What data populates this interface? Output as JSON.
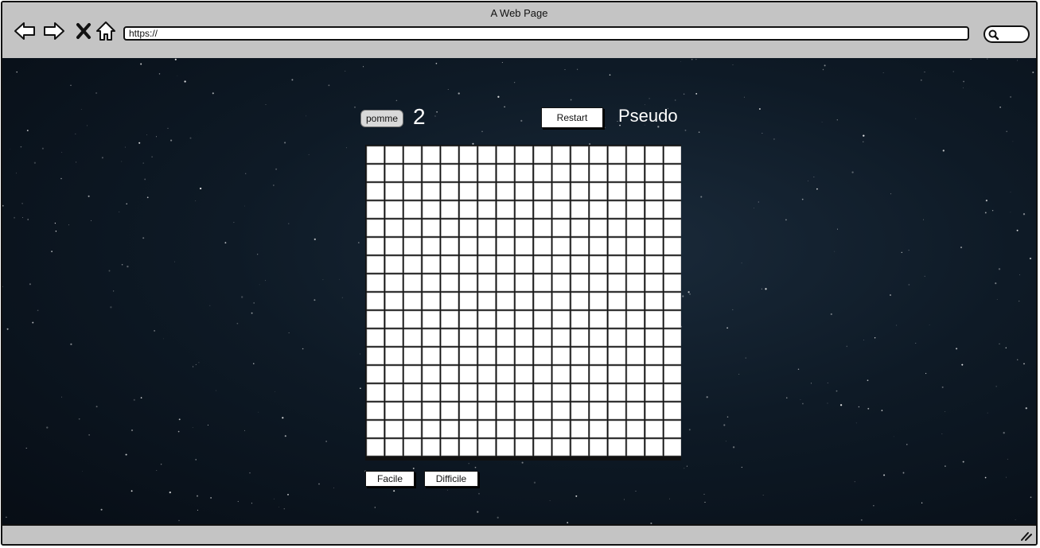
{
  "window": {
    "title": "A Web Page",
    "url": "https://"
  },
  "game": {
    "apple_label": "pomme",
    "score": "2",
    "restart_label": "Restart",
    "player_name": "Pseudo",
    "grid": {
      "columns": 17,
      "rows": 17
    },
    "modes": [
      "Facile",
      "Difficile"
    ]
  },
  "colors": {
    "chrome": "#c4c4c4",
    "background": "#0e1a26",
    "cell": "#ffffff",
    "grid_line": "#111111"
  },
  "icons": [
    "back-arrow-icon",
    "forward-arrow-icon",
    "close-icon",
    "home-icon",
    "search-icon",
    "resize-grip-icon"
  ]
}
